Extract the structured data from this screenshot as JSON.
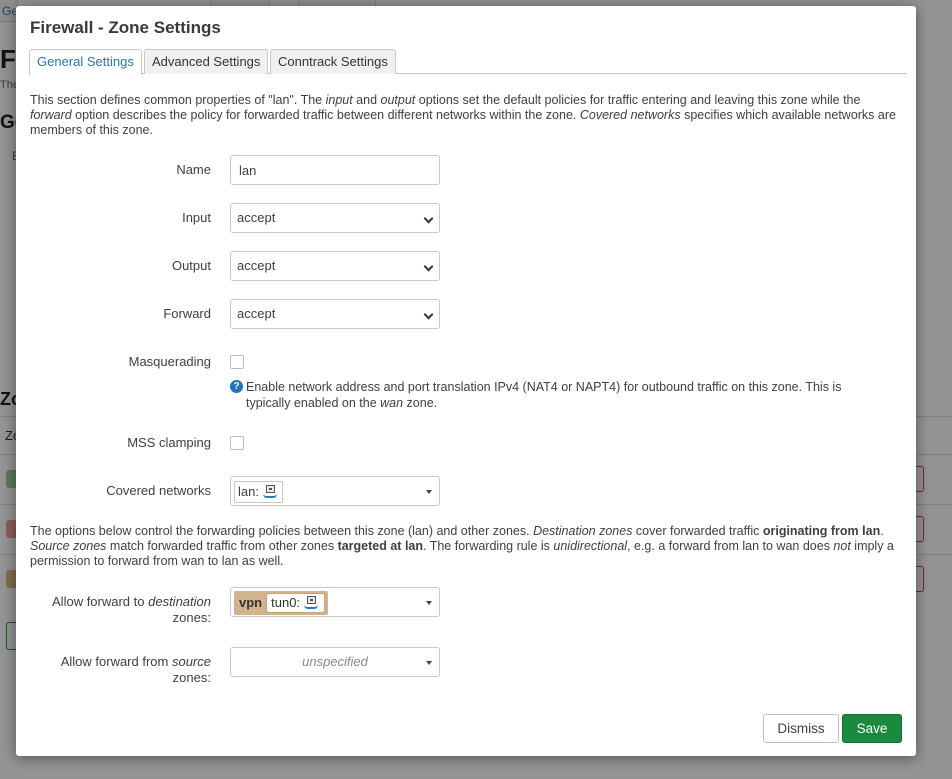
{
  "background": {
    "tab_fragment": "Ge",
    "headings": [
      "Fi",
      "Ge",
      "Zo"
    ],
    "sub_fragments": [
      "The",
      "B",
      "Zo"
    ]
  },
  "modal": {
    "title": "Firewall - Zone Settings",
    "tabs": [
      {
        "label": "General Settings",
        "active": true
      },
      {
        "label": "Advanced Settings",
        "active": false
      },
      {
        "label": "Conntrack Settings",
        "active": false
      }
    ],
    "intro": {
      "p1": "This section defines common properties of \"lan\". The ",
      "i1": "input",
      "p2": " and ",
      "i2": "output",
      "p3": " options set the default policies for traffic entering and leaving this zone while the ",
      "i3": "forward",
      "p4": " option describes the policy for forwarded traffic between different networks within the zone. ",
      "i4": "Covered networks",
      "p5": " specifies which available networks are members of this zone."
    },
    "fields": {
      "name": {
        "label": "Name",
        "value": "lan"
      },
      "input": {
        "label": "Input",
        "value": "accept",
        "options": [
          "accept"
        ]
      },
      "output": {
        "label": "Output",
        "value": "accept",
        "options": [
          "accept"
        ]
      },
      "forward": {
        "label": "Forward",
        "value": "accept",
        "options": [
          "accept"
        ]
      },
      "masquerading": {
        "label": "Masquerading",
        "checked": false,
        "help_prefix": "Enable network address and port translation IPv4 (NAT4 or NAPT4) for outbound traffic on this zone. This is typically enabled on the ",
        "help_italic": "wan",
        "help_suffix": " zone."
      },
      "mss_clamping": {
        "label": "MSS clamping",
        "checked": false
      },
      "covered_networks": {
        "label": "Covered networks",
        "value": "lan:",
        "icon": "network-interface-icon"
      }
    },
    "forwarding_intro": {
      "p1": "The options below control the forwarding policies between this zone (lan) and other zones. ",
      "i1": "Destination zones",
      "p2": " cover forwarded traffic ",
      "b1": "originating from lan",
      "p3": ". ",
      "i2": "Source zones",
      "p4": " match forwarded traffic from other zones ",
      "b2": "targeted at lan",
      "p5": ". The forwarding rule is ",
      "i3": "unidirectional",
      "p6": ", e.g. a forward from lan to wan does ",
      "i4": "not",
      "p7": " imply a permission to forward from wan to lan as well."
    },
    "forward_dest": {
      "label_prefix": "Allow forward to ",
      "label_italic": "destination",
      "label_line2": "zones",
      "label_colon": ":",
      "zone": "vpn",
      "zone_color": "#d2b48c",
      "device": "tun0:"
    },
    "forward_src": {
      "label_prefix": "Allow forward from ",
      "label_italic": "source",
      "label_line2": "zones",
      "label_colon": ":",
      "placeholder": "unspecified"
    },
    "buttons": {
      "dismiss": "Dismiss",
      "save": "Save",
      "save_color": "#1c8a3e"
    }
  }
}
